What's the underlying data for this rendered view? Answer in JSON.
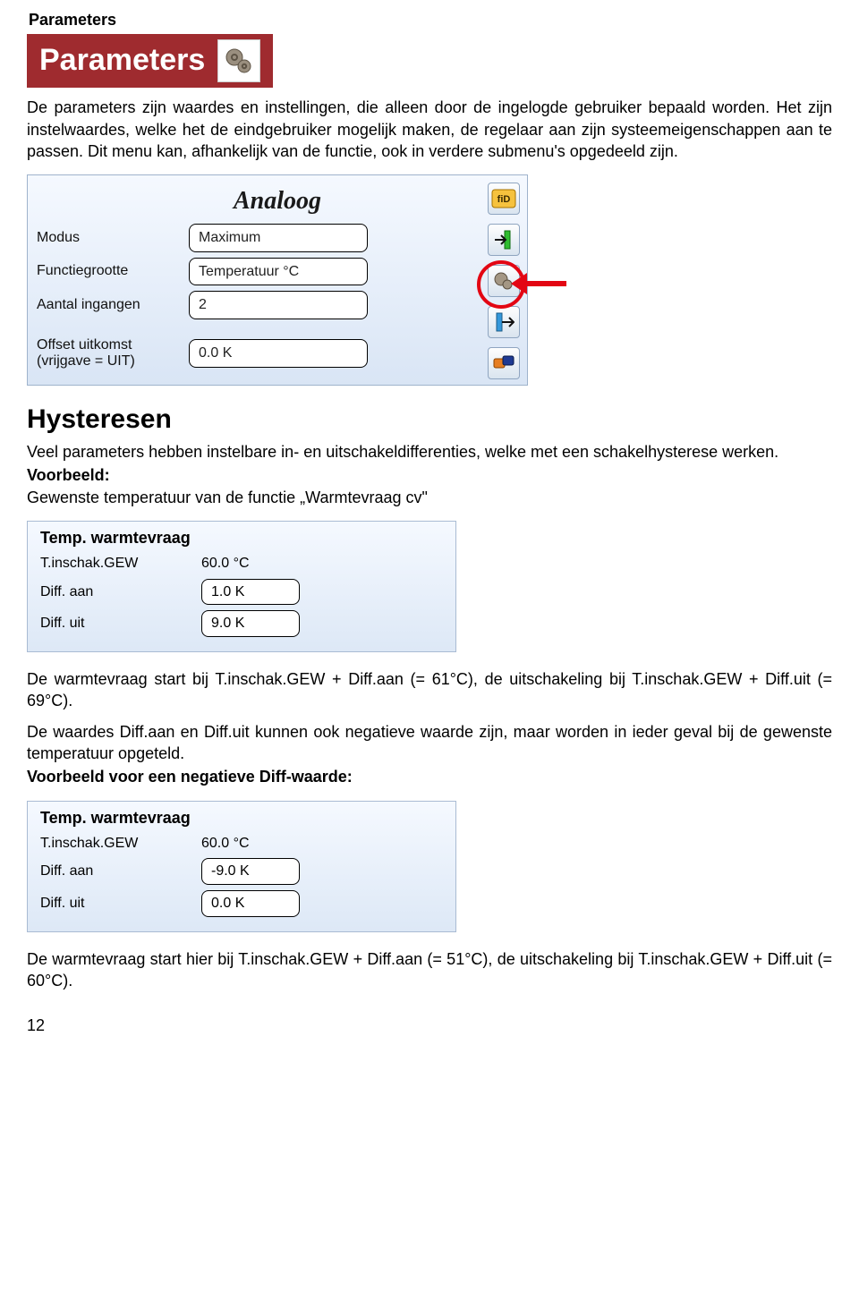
{
  "header": {
    "byline": "Parameters",
    "title": "Parameters"
  },
  "intro": "De parameters zijn waardes en instellingen, die alleen door de ingelogde gebruiker bepaald worden. Het zijn instelwaardes, welke het de eindgebruiker mogelijk maken, de regelaar aan zijn systeemeigenschappen aan te passen. Dit menu kan, afhankelijk van de functie, ook in verdere submenu's opgedeeld zijn.",
  "panel1": {
    "title": "Analoog",
    "rows": {
      "modus": {
        "label": "Modus",
        "value": "Maximum"
      },
      "functiegrootte": {
        "label": "Functiegrootte",
        "value": "Temperatuur °C"
      },
      "aantal_ingangen": {
        "label": "Aantal ingangen",
        "value": "2"
      },
      "offset": {
        "label": "Offset uitkomst\n(vrijgave = UIT)",
        "value": "0.0 K"
      }
    }
  },
  "hysteresen": {
    "heading": "Hysteresen",
    "p1": "Veel parameters hebben instelbare in- en uitschakeldifferenties, welke met een schakelhysterese werken.",
    "voorbeeld_label": "Voorbeeld:",
    "voorbeeld_text": "Gewenste temperatuur van de functie „Warmtevraag cv\""
  },
  "panel2": {
    "title": "Temp. warmtevraag",
    "rows": {
      "t_inschak": {
        "label": "T.inschak.GEW",
        "value": "60.0 °C"
      },
      "diff_aan": {
        "label": "Diff. aan",
        "value": "1.0 K"
      },
      "diff_uit": {
        "label": "Diff. uit",
        "value": "9.0 K"
      }
    }
  },
  "explain1": "De warmtevraag start bij T.inschak.GEW + Diff.aan (= 61°C), de uitschakeling bij T.inschak.GEW + Diff.uit (= 69°C).",
  "explain2": "De waardes Diff.aan en Diff.uit kunnen ook negatieve waarde zijn, maar worden in ieder geval bij de gewenste temperatuur opgeteld.",
  "voorbeeld2_label": "Voorbeeld voor een negatieve Diff-waarde:",
  "panel3": {
    "title": "Temp. warmtevraag",
    "rows": {
      "t_inschak": {
        "label": "T.inschak.GEW",
        "value": "60.0 °C"
      },
      "diff_aan": {
        "label": "Diff. aan",
        "value": "-9.0 K"
      },
      "diff_uit": {
        "label": "Diff. uit",
        "value": "0.0 K"
      }
    }
  },
  "explain3": "De warmtevraag start hier bij T.inschak.GEW + Diff.aan (= 51°C), de uitschakeling bij T.inschak.GEW + Diff.uit (= 60°C).",
  "page_number": "12"
}
